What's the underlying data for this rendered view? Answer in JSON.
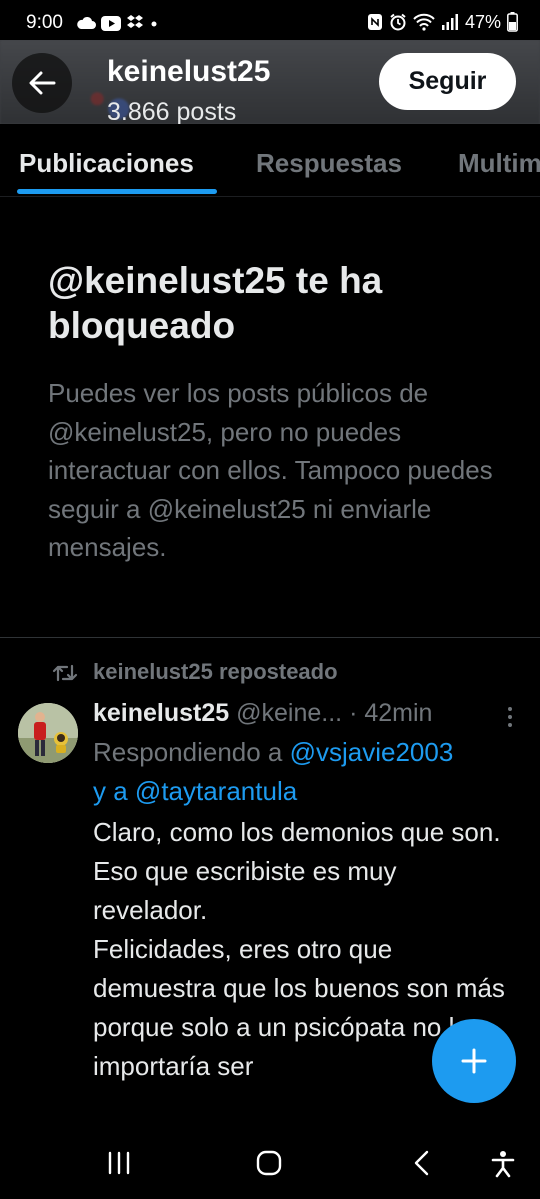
{
  "status_bar": {
    "time": "9:00",
    "battery": "47%",
    "left_icons": [
      "cloud-icon",
      "youtube-icon",
      "dropbox-icon",
      "dot-icon"
    ],
    "right_icons": [
      "nfc-icon",
      "alarm-icon",
      "wifi-icon",
      "signal-icon",
      "battery-icon"
    ]
  },
  "header": {
    "display_name": "keinelust25",
    "post_count": "3.866 posts",
    "follow_label": "Seguir"
  },
  "tabs": [
    {
      "label": "Publicaciones",
      "active": true
    },
    {
      "label": "Respuestas",
      "active": false
    },
    {
      "label": "Multimedia",
      "active": false
    }
  ],
  "blocked": {
    "title": "@keinelust25 te ha bloqueado",
    "description": "Puedes ver los posts públicos de @keinelust25, pero no puedes interactuar con ellos. Tampoco puedes seguir a @keinelust25 ni enviarle mensajes."
  },
  "tweet": {
    "repost_label": "keinelust25 reposteado",
    "name": "keinelust25",
    "handle": "@keine...",
    "time": "· 42min",
    "replying_prefix": "Respondiendo a ",
    "mention1": "@vsjavie2003",
    "mention_joiner": "y a ",
    "mention2": "@taytarantula",
    "body_lines": [
      "Claro, como los demonios que son.",
      "Eso que escribiste es muy revelador.",
      "Felicidades, eres otro que demuestra que los buenos son más porque solo a un psicópata no le importaría ser"
    ]
  },
  "colors": {
    "accent": "#1d9bf0",
    "background": "#000000",
    "secondary_text": "#71767b"
  }
}
